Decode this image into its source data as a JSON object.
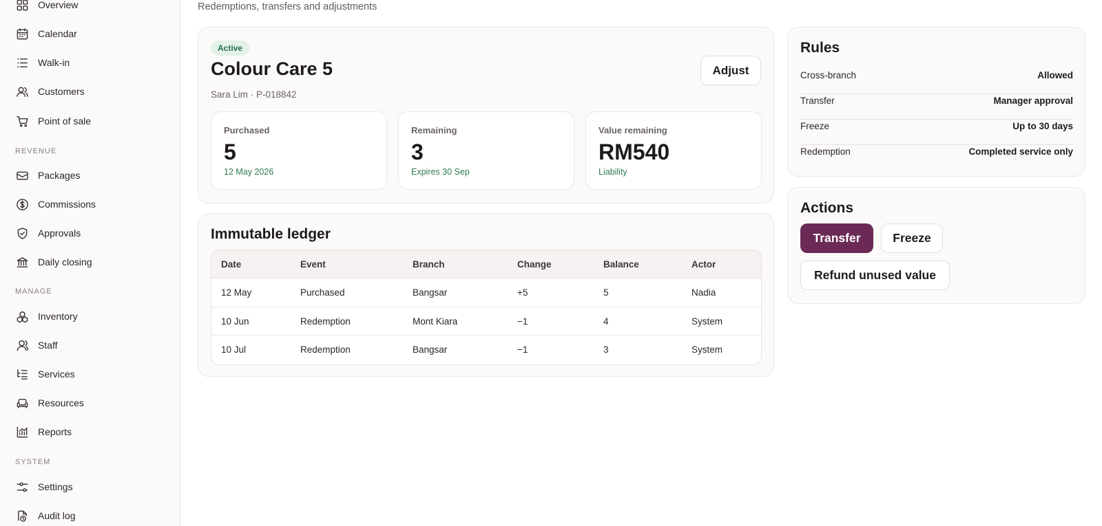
{
  "sidebar": {
    "items": [
      {
        "label": "Overview",
        "icon": "grid-icon"
      },
      {
        "label": "Calendar",
        "icon": "calendar-icon"
      },
      {
        "label": "Walk-in",
        "icon": "list-icon"
      },
      {
        "label": "Customers",
        "icon": "users-icon"
      },
      {
        "label": "Point of sale",
        "icon": "cart-icon"
      },
      {
        "label": "Packages",
        "icon": "ticket-icon"
      },
      {
        "label": "Commissions",
        "icon": "dollar-circle-icon"
      },
      {
        "label": "Approvals",
        "icon": "shield-check-icon"
      },
      {
        "label": "Daily closing",
        "icon": "bank-icon"
      },
      {
        "label": "Inventory",
        "icon": "boxes-icon"
      },
      {
        "label": "Staff",
        "icon": "user-icon"
      },
      {
        "label": "Services",
        "icon": "list-tree-icon"
      },
      {
        "label": "Resources",
        "icon": "sofa-icon"
      },
      {
        "label": "Reports",
        "icon": "chart-icon"
      },
      {
        "label": "Settings",
        "icon": "sliders-icon"
      },
      {
        "label": "Audit log",
        "icon": "file-clock-icon"
      }
    ],
    "sections": {
      "revenue": "REVENUE",
      "manage": "MANAGE",
      "system": "SYSTEM"
    }
  },
  "page": {
    "subtitle": "Redemptions, transfers and adjustments"
  },
  "package": {
    "status": "Active",
    "title": "Colour Care 5",
    "customer": "Sara Lim · P-018842",
    "adjust_label": "Adjust",
    "stats": [
      {
        "label": "Purchased",
        "value": "5",
        "note": "12 May 2026"
      },
      {
        "label": "Remaining",
        "value": "3",
        "note": "Expires 30 Sep"
      },
      {
        "label": "Value remaining",
        "value": "RM540",
        "note": "Liability"
      }
    ]
  },
  "ledger": {
    "title": "Immutable ledger",
    "columns": [
      "Date",
      "Event",
      "Branch",
      "Change",
      "Balance",
      "Actor"
    ],
    "rows": [
      [
        "12 May",
        "Purchased",
        "Bangsar",
        "+5",
        "5",
        "Nadia"
      ],
      [
        "10 Jun",
        "Redemption",
        "Mont Kiara",
        "−1",
        "4",
        "System"
      ],
      [
        "10 Jul",
        "Redemption",
        "Bangsar",
        "−1",
        "3",
        "System"
      ]
    ]
  },
  "rules": {
    "title": "Rules",
    "items": [
      {
        "key": "Cross-branch",
        "value": "Allowed"
      },
      {
        "key": "Transfer",
        "value": "Manager approval"
      },
      {
        "key": "Freeze",
        "value": "Up to 30 days"
      },
      {
        "key": "Redemption",
        "value": "Completed service only"
      }
    ]
  },
  "actions": {
    "title": "Actions",
    "transfer_label": "Transfer",
    "freeze_label": "Freeze",
    "refund_label": "Refund unused value"
  },
  "colors": {
    "accent": "#6b2a55",
    "status_active_bg": "#e3f1e8",
    "status_active_text": "#24704a",
    "note_green": "#2f7a52"
  }
}
